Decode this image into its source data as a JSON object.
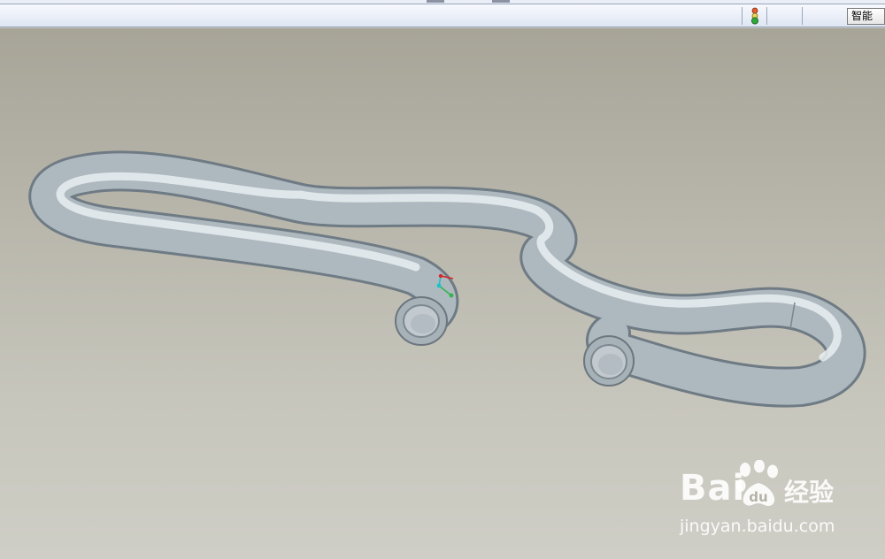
{
  "status_bar": {
    "regen_indicator": "traffic-light-icon",
    "filter_label": "智能"
  },
  "viewport": {
    "background_top": "#a7a498",
    "background_bottom": "#cfcec6",
    "model_color": "#b4bdc4",
    "model_icon": "pipe-model"
  },
  "watermark": {
    "brand": "Bai",
    "brand_suffix": "经验",
    "url": "jingyan.baidu.com"
  }
}
